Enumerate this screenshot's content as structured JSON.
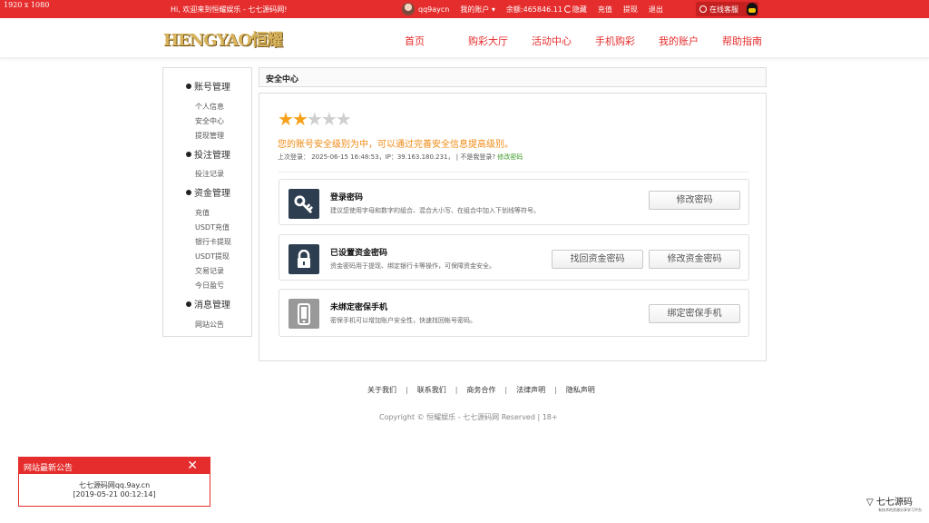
{
  "resolution": "1920 x 1080",
  "top": {
    "welcome": "Hi, 欢迎来到恒耀娱乐 - 七七源码网!",
    "username": "qq9aycn",
    "my_account": "我的账户 ▾",
    "balance_label": "余额:",
    "balance": "465846.11",
    "hide": "隐藏",
    "deposit": "充值",
    "withdraw": "提现",
    "logout": "退出",
    "customer_service": "在线客服"
  },
  "header": {
    "logo": "HENGYAO恒耀",
    "nav": [
      "首页",
      "购彩大厅",
      "活动中心",
      "手机购彩",
      "我的账户",
      "帮助指南"
    ]
  },
  "sidebar": {
    "groups": [
      {
        "title": "账号管理",
        "items": [
          "个人信息",
          "安全中心",
          "提现管理"
        ]
      },
      {
        "title": "投注管理",
        "items": [
          "投注记录"
        ]
      },
      {
        "title": "资金管理",
        "items": [
          "充值",
          "USDT充值",
          "银行卡提现",
          "USDT提现",
          "交易记录",
          "今日盈亏"
        ]
      },
      {
        "title": "消息管理",
        "items": [
          "网站公告"
        ]
      }
    ]
  },
  "security": {
    "panel_title": "安全中心",
    "stars_filled": 2,
    "stars_total": 5,
    "level_text": "您的账号安全级别为中，可以通过完善安全信息提高级别。",
    "last_login": "上次登录：  2025-06-15 16:48:53，IP：39.163.180.231，  | 不是我登录?",
    "change_password_link": "修改密码",
    "cards": [
      {
        "title": "登录密码",
        "desc": "建议您使用字母和数字的组合、混合大小写、在组合中加入下划线等符号。",
        "buttons": [
          "修改密码"
        ]
      },
      {
        "title": "已设置资金密码",
        "desc": "资金密码用于提现、绑定银行卡等操作，可保障资金安全。",
        "buttons": [
          "找回资金密码",
          "修改资金密码"
        ]
      },
      {
        "title": "未绑定密保手机",
        "desc": "密保手机可以增加账户安全性，快速找回帐号密码。",
        "buttons": [
          "绑定密保手机"
        ]
      }
    ]
  },
  "footer": {
    "links": [
      "关于我们",
      "联系我们",
      "商务合作",
      "法律声明",
      "隐私声明"
    ],
    "copyright": "Copyright © 恒耀娱乐 - 七七源码网 Reserved | 18+"
  },
  "notice": {
    "title": "网站最新公告",
    "line1": "七七源码网qq.9ay.cn",
    "line2": "[2019-05-21 00:12:14]"
  },
  "watermark": {
    "text": "七七源码",
    "subtext": "有技术的资源分享学习平台"
  },
  "colors": {
    "brand_red": "#e52d2d",
    "warning_orange": "#f08a13",
    "star_gold": "#f7a11b",
    "link_green": "#3c9b28"
  }
}
